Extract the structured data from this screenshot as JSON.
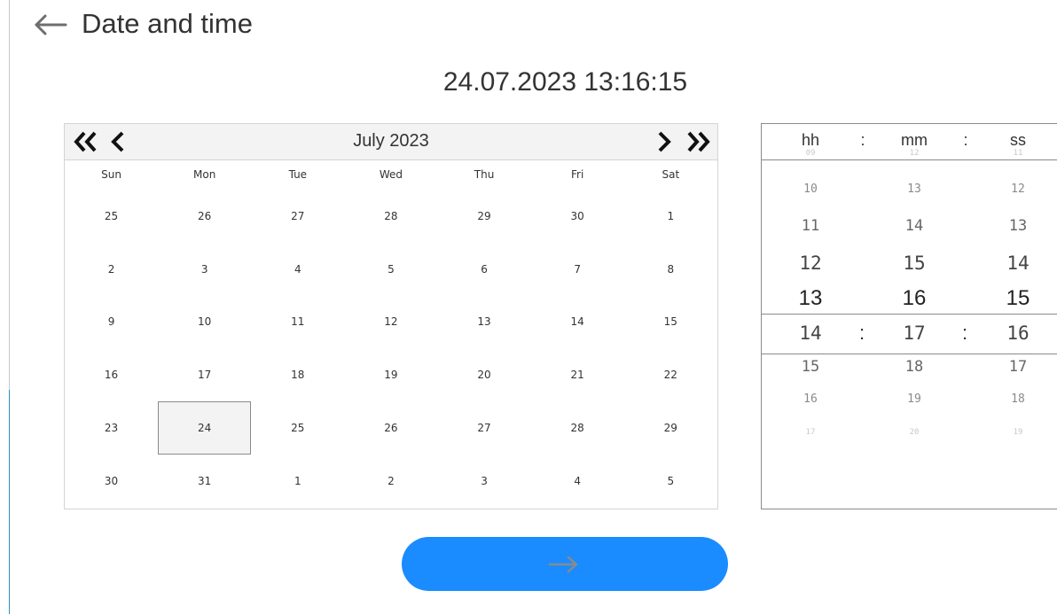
{
  "header": {
    "title": "Date and time",
    "back_icon": "arrow-left-icon"
  },
  "current_datetime": "24.07.2023 13:16:15",
  "calendar": {
    "month_label": "July 2023",
    "nav_icons": [
      "double-chevron-left-icon",
      "chevron-left-icon",
      "chevron-right-icon",
      "double-chevron-right-icon"
    ],
    "weekdays": [
      "Sun",
      "Mon",
      "Tue",
      "Wed",
      "Thu",
      "Fri",
      "Sat"
    ],
    "days": [
      [
        "25",
        "26",
        "27",
        "28",
        "29",
        "30",
        "1"
      ],
      [
        "2",
        "3",
        "4",
        "5",
        "6",
        "7",
        "8"
      ],
      [
        "9",
        "10",
        "11",
        "12",
        "13",
        "14",
        "15"
      ],
      [
        "16",
        "17",
        "18",
        "19",
        "20",
        "21",
        "22"
      ],
      [
        "23",
        "24",
        "25",
        "26",
        "27",
        "28",
        "29"
      ],
      [
        "30",
        "31",
        "1",
        "2",
        "3",
        "4",
        "5"
      ]
    ],
    "selected_day": "24"
  },
  "time_picker": {
    "headers": {
      "hours": "hh",
      "minutes": "mm",
      "seconds": "ss",
      "separator": ":"
    },
    "hours": [
      "09",
      "10",
      "11",
      "12",
      "13",
      "14",
      "15",
      "16",
      "17"
    ],
    "minutes": [
      "12",
      "13",
      "14",
      "15",
      "16",
      "17",
      "18",
      "19",
      "20"
    ],
    "seconds": [
      "11",
      "12",
      "13",
      "14",
      "15",
      "16",
      "17",
      "18",
      "19"
    ],
    "selected": {
      "hours": "13",
      "minutes": "16",
      "seconds": "15"
    }
  },
  "confirm_button": {
    "icon": "arrow-right-icon",
    "color": "#1a8cff"
  }
}
